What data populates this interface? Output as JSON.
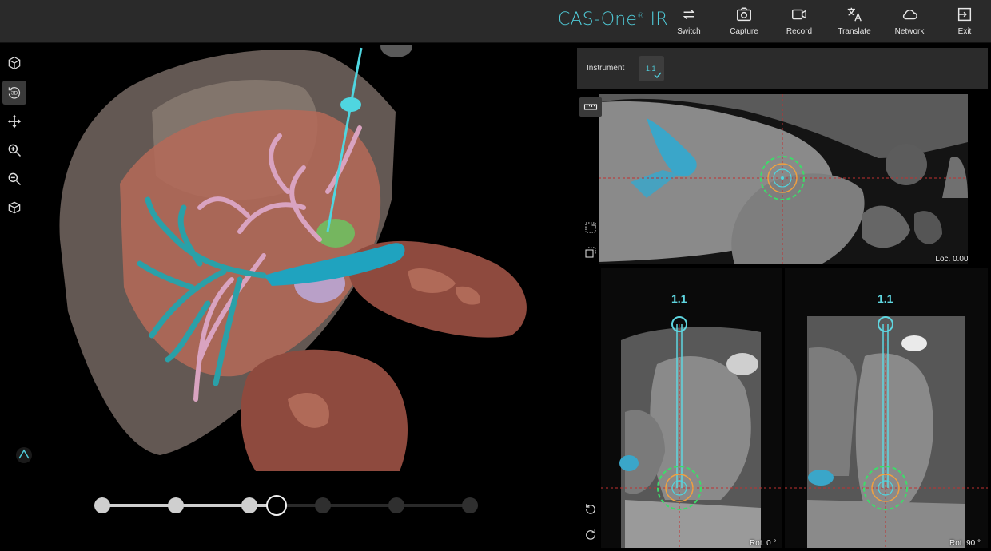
{
  "app": {
    "brand": "CAS-One",
    "brand_reg": "®",
    "brand_suffix": " IR"
  },
  "toolbar": {
    "buttons": [
      {
        "id": "switch",
        "label": "Switch",
        "icon": "switch-arrows-icon"
      },
      {
        "id": "capture",
        "label": "Capture",
        "icon": "camera-icon"
      },
      {
        "id": "record",
        "label": "Record",
        "icon": "video-camera-icon"
      },
      {
        "id": "translate",
        "label": "Translate",
        "icon": "translate-icon"
      },
      {
        "id": "network",
        "label": "Network",
        "icon": "cloud-icon"
      },
      {
        "id": "exit",
        "label": "Exit",
        "icon": "exit-icon"
      }
    ]
  },
  "left_tools": [
    {
      "id": "cube",
      "icon": "cube-view-icon"
    },
    {
      "id": "rotate3d",
      "icon": "rotate-3d-icon",
      "label": "3D",
      "active": true
    },
    {
      "id": "pan",
      "icon": "pan-move-icon"
    },
    {
      "id": "zoomin",
      "icon": "zoom-in-icon"
    },
    {
      "id": "zoomout",
      "icon": "zoom-out-icon"
    },
    {
      "id": "reset",
      "icon": "reset-view-icon"
    }
  ],
  "timeline": {
    "steps": 8,
    "current_step": 4
  },
  "instrument": {
    "label": "Instrument",
    "id": "1.1"
  },
  "views": {
    "axial": {
      "loc_text": "Loc. 0.00 mm"
    },
    "left": {
      "needle": "1.1",
      "rot_text": "Rot. 0 °"
    },
    "right": {
      "needle": "1.1",
      "rot_text": "Rot. 90 °"
    }
  },
  "colors": {
    "accent": "#4fc9d6",
    "topbar": "#2a2a2a",
    "target_green": "#3ddc6a",
    "target_orange": "#f0a040"
  }
}
